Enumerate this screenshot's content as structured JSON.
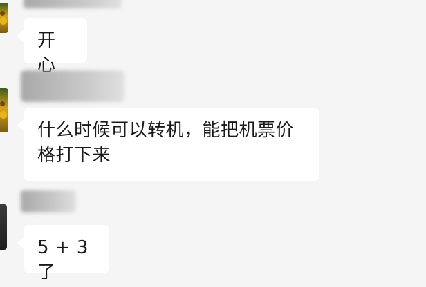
{
  "chat": {
    "messages": [
      {
        "text": "开心"
      },
      {
        "text": "什么时候可以转机，能把机票价格打下来"
      },
      {
        "text": "5 + 3了"
      }
    ]
  }
}
